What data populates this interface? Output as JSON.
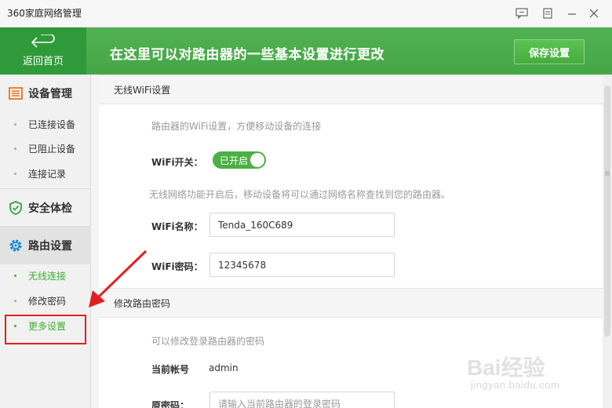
{
  "app": {
    "title": "360家庭网络管理"
  },
  "header": {
    "back_label": "返回首页",
    "title": "在这里可以对路由器的一些基本设置进行更改",
    "save_label": "保存设置"
  },
  "sidebar": {
    "sections": [
      {
        "label": "设备管理",
        "icon": "device-list-icon"
      },
      {
        "label": "安全体检",
        "icon": "shield-check-icon"
      },
      {
        "label": "路由设置",
        "icon": "gear-icon"
      }
    ],
    "device_items": [
      "已连接设备",
      "已阻止设备",
      "连接记录"
    ],
    "router_items": [
      "无线连接",
      "修改密码",
      "更多设置"
    ],
    "current_item": "无线连接"
  },
  "wifi_section": {
    "heading": "无线WiFi设置",
    "hint": "路由器的WiFi设置，方便移动设备的连接",
    "switch_label": "WiFi开关：",
    "switch_state": "已开启",
    "switch_hint": "无线网络功能开启后，移动设备将可以通过网络名称查找到您的路由器。",
    "name_label": "WiFi名称：",
    "name_value": "Tenda_160C689",
    "password_label": "WiFi密码：",
    "password_value": "12345678"
  },
  "password_section": {
    "heading": "修改路由密码",
    "hint": "可以修改登录路由器的密码",
    "account_label": "当前帐号",
    "account_value": "admin",
    "old_password_label": "原密码：",
    "old_password_placeholder": "请输入当前路由器的登录密码"
  },
  "watermark": {
    "main": "Bai经验",
    "sub": "jingyan.baidu.com"
  },
  "colors": {
    "brand_green": "#4caf50",
    "highlight_red": "#e02020",
    "active_item": "#3caf2f"
  }
}
